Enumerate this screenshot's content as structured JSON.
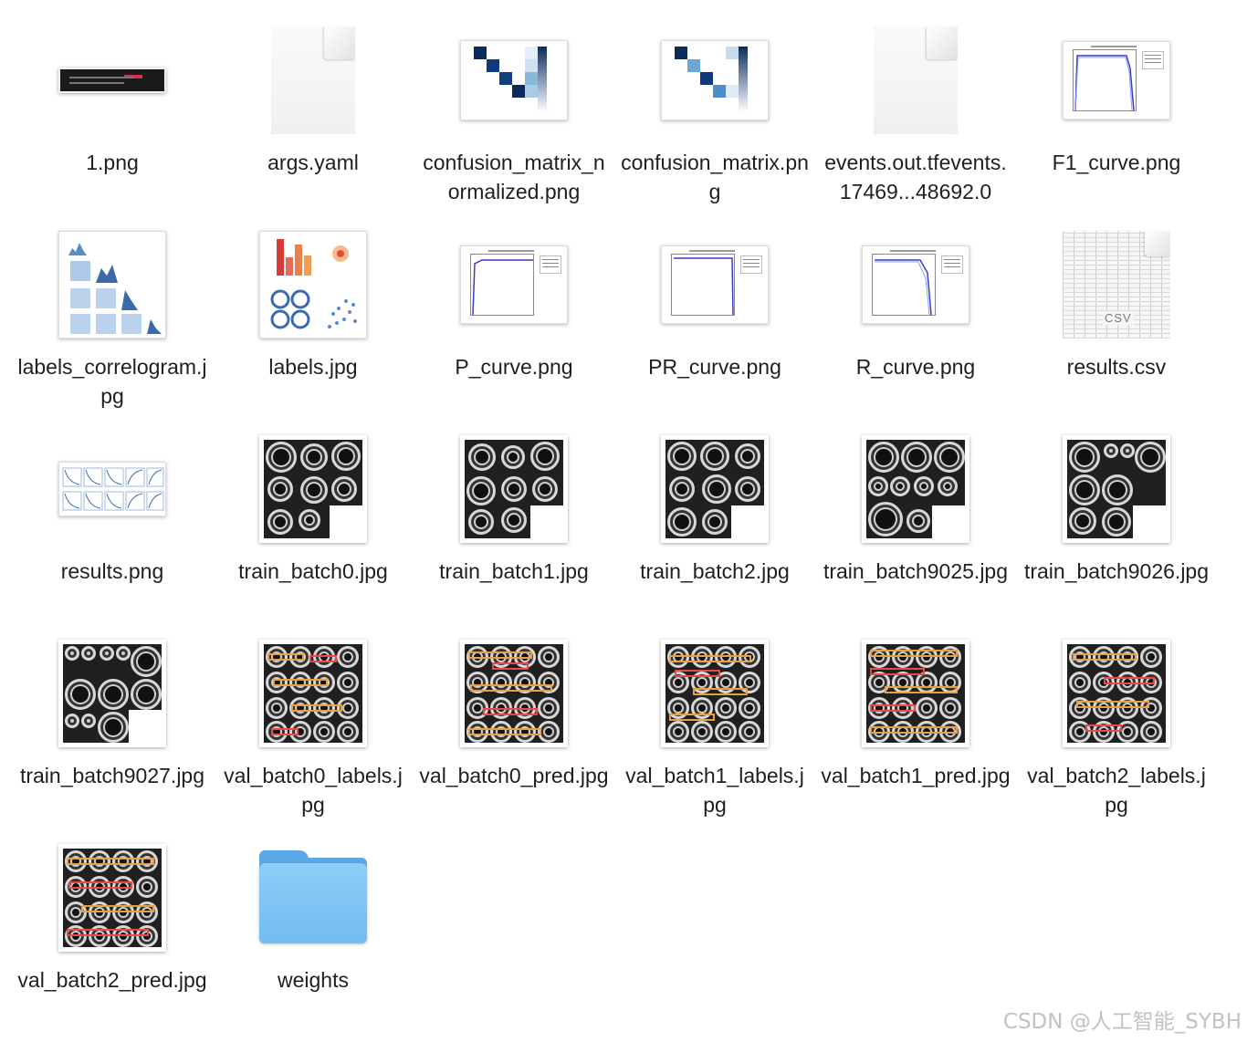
{
  "files": [
    {
      "name": "1.png",
      "kind": "strip"
    },
    {
      "name": "args.yaml",
      "kind": "doc"
    },
    {
      "name": "confusion_matrix_normalized.png",
      "kind": "cm"
    },
    {
      "name": "confusion_matrix.png",
      "kind": "cm"
    },
    {
      "name": "events.out.tfevents.17469...48692.0",
      "kind": "doc"
    },
    {
      "name": "F1_curve.png",
      "kind": "curve"
    },
    {
      "name": "labels_correlogram.jpg",
      "kind": "correlogram"
    },
    {
      "name": "labels.jpg",
      "kind": "labels"
    },
    {
      "name": "P_curve.png",
      "kind": "curve"
    },
    {
      "name": "PR_curve.png",
      "kind": "curve"
    },
    {
      "name": "R_curve.png",
      "kind": "curve"
    },
    {
      "name": "results.csv",
      "kind": "csv"
    },
    {
      "name": "results.png",
      "kind": "results"
    },
    {
      "name": "train_batch0.jpg",
      "kind": "batch"
    },
    {
      "name": "train_batch1.jpg",
      "kind": "batch"
    },
    {
      "name": "train_batch2.jpg",
      "kind": "batch"
    },
    {
      "name": "train_batch9025.jpg",
      "kind": "batch"
    },
    {
      "name": "train_batch9026.jpg",
      "kind": "batch"
    },
    {
      "name": "train_batch9027.jpg",
      "kind": "batch"
    },
    {
      "name": "val_batch0_labels.jpg",
      "kind": "valbatch"
    },
    {
      "name": "val_batch0_pred.jpg",
      "kind": "valbatch"
    },
    {
      "name": "val_batch1_labels.jpg",
      "kind": "valbatch"
    },
    {
      "name": "val_batch1_pred.jpg",
      "kind": "valbatch"
    },
    {
      "name": "val_batch2_labels.jpg",
      "kind": "valbatch"
    },
    {
      "name": "val_batch2_pred.jpg",
      "kind": "valbatch"
    },
    {
      "name": "weights",
      "kind": "folder"
    }
  ],
  "csv_badge": "CSV",
  "watermark": "CSDN @人工智能_SYBH",
  "colors": {
    "folder": "#73bbf1",
    "cm_dark": "#0b2b5c",
    "box_orange": "#e8a040",
    "box_red": "#e84a4a"
  }
}
